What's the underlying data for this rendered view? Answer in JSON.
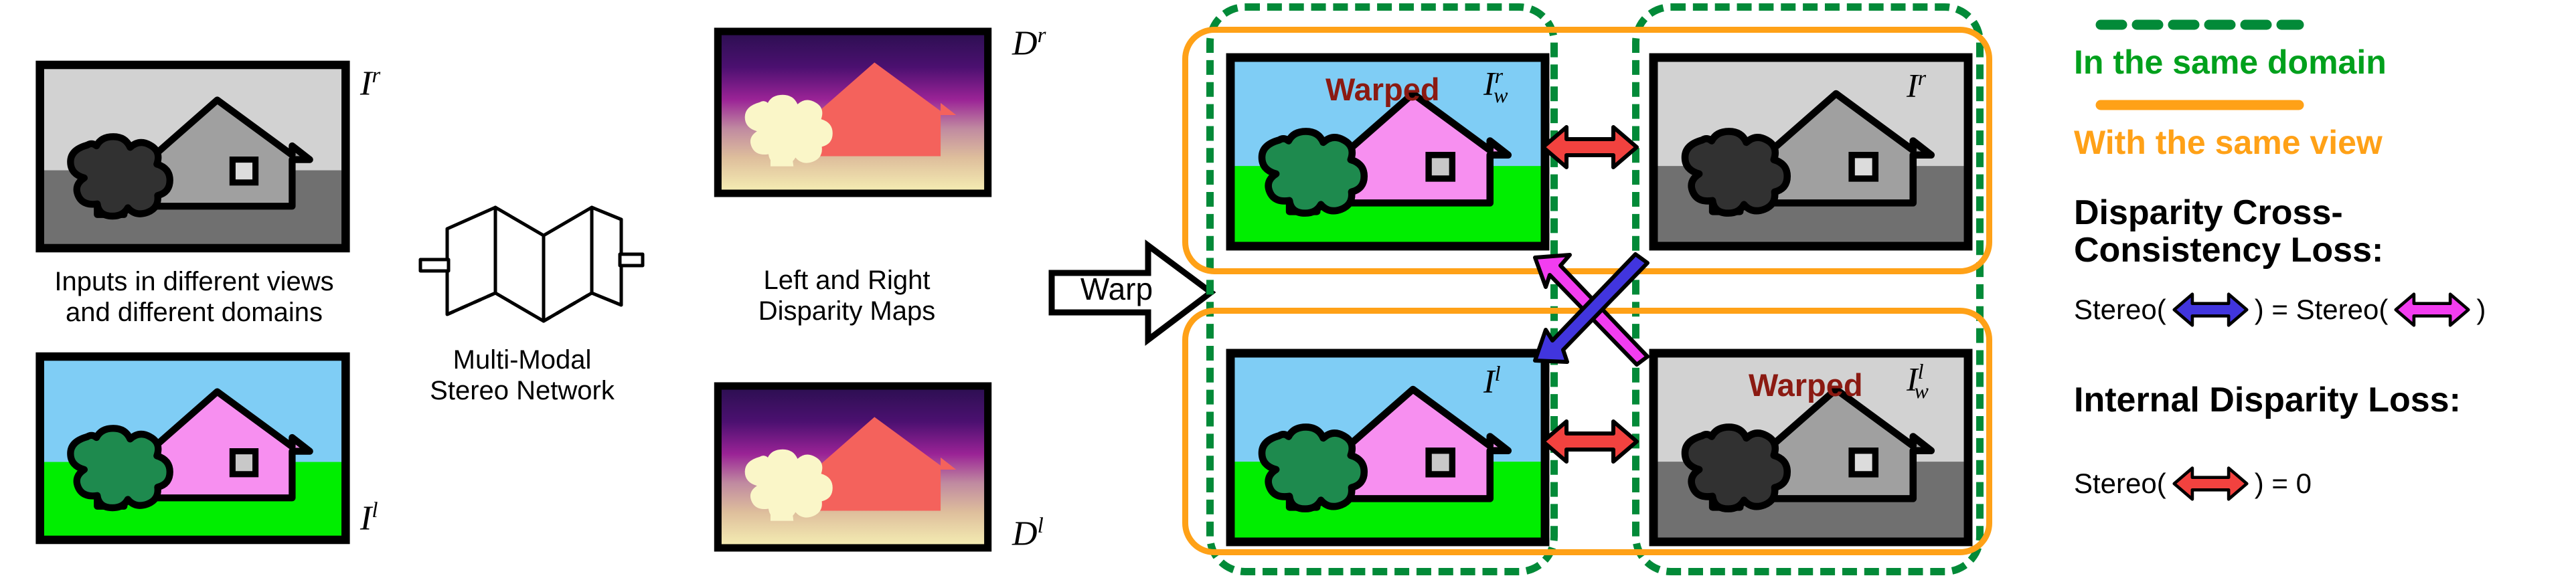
{
  "inputs": {
    "top_label": "I^r",
    "top_label_parts": {
      "base": "I",
      "sup": "r"
    },
    "bottom_label_parts": {
      "base": "I",
      "sup": "l"
    },
    "caption": "Inputs in different views\nand different domains"
  },
  "network": {
    "caption": "Multi-Modal\nStereo Network",
    "icon": "hourglass-network-icon"
  },
  "disparity": {
    "top_label_parts": {
      "base": "D",
      "sup": "r"
    },
    "bottom_label_parts": {
      "base": "D",
      "sup": "l"
    },
    "caption": "Left and Right\nDisparity Maps"
  },
  "warp_arrow": {
    "label": "Warp"
  },
  "panel": {
    "cells": [
      {
        "id": "warped-Ir",
        "warped_label": "Warped",
        "math": {
          "base": "I",
          "sup": "r",
          "sub": "w"
        },
        "style": "color"
      },
      {
        "id": "Ir",
        "warped_label": "",
        "math": {
          "base": "I",
          "sup": "r",
          "sub": ""
        },
        "style": "gray"
      },
      {
        "id": "Il",
        "warped_label": "",
        "math": {
          "base": "I",
          "sup": "l",
          "sub": ""
        },
        "style": "color"
      },
      {
        "id": "warped-Il",
        "warped_label": "Warped",
        "math": {
          "base": "I",
          "sup": "l",
          "sub": "w"
        },
        "style": "gray"
      }
    ]
  },
  "legend": {
    "domain_label": "In the same domain",
    "view_label": "With the same view",
    "loss1_title": "Disparity Cross-\nConsistency Loss:",
    "loss1_eq_left": "Stereo(",
    "loss1_eq_mid": ") = Stereo(",
    "loss1_eq_right": ")",
    "loss2_title": "Internal Disparity Loss:",
    "loss2_eq_left": "Stereo(",
    "loss2_eq_right": ") = 0"
  },
  "colors": {
    "green_dashed": "#028A38",
    "orange_solid": "#FFA117",
    "legend_green_text": "#00A01C",
    "legend_orange_text": "#FFA117",
    "red_arrow": "#F2423F",
    "blue_arrow": "#4135DE",
    "magenta_arrow": "#F23DF0",
    "warped_text": "#8B1A12",
    "sky": "#7FCDF5",
    "grass": "#00EE00",
    "tree": "#1E8A4E",
    "trunk": "#8B4513",
    "house": "#F78FF0",
    "gray_sky": "#D2D2D2",
    "gray_ground": "#707070",
    "gray_tree": "#313131",
    "gray_house": "#A0A0A0",
    "disp_top": "#2B0F50",
    "disp_mid": "#9A2396",
    "disp_bot": "#F6F0B4",
    "disp_house": "#F4625C",
    "disp_tree": "#FAF6C8"
  }
}
